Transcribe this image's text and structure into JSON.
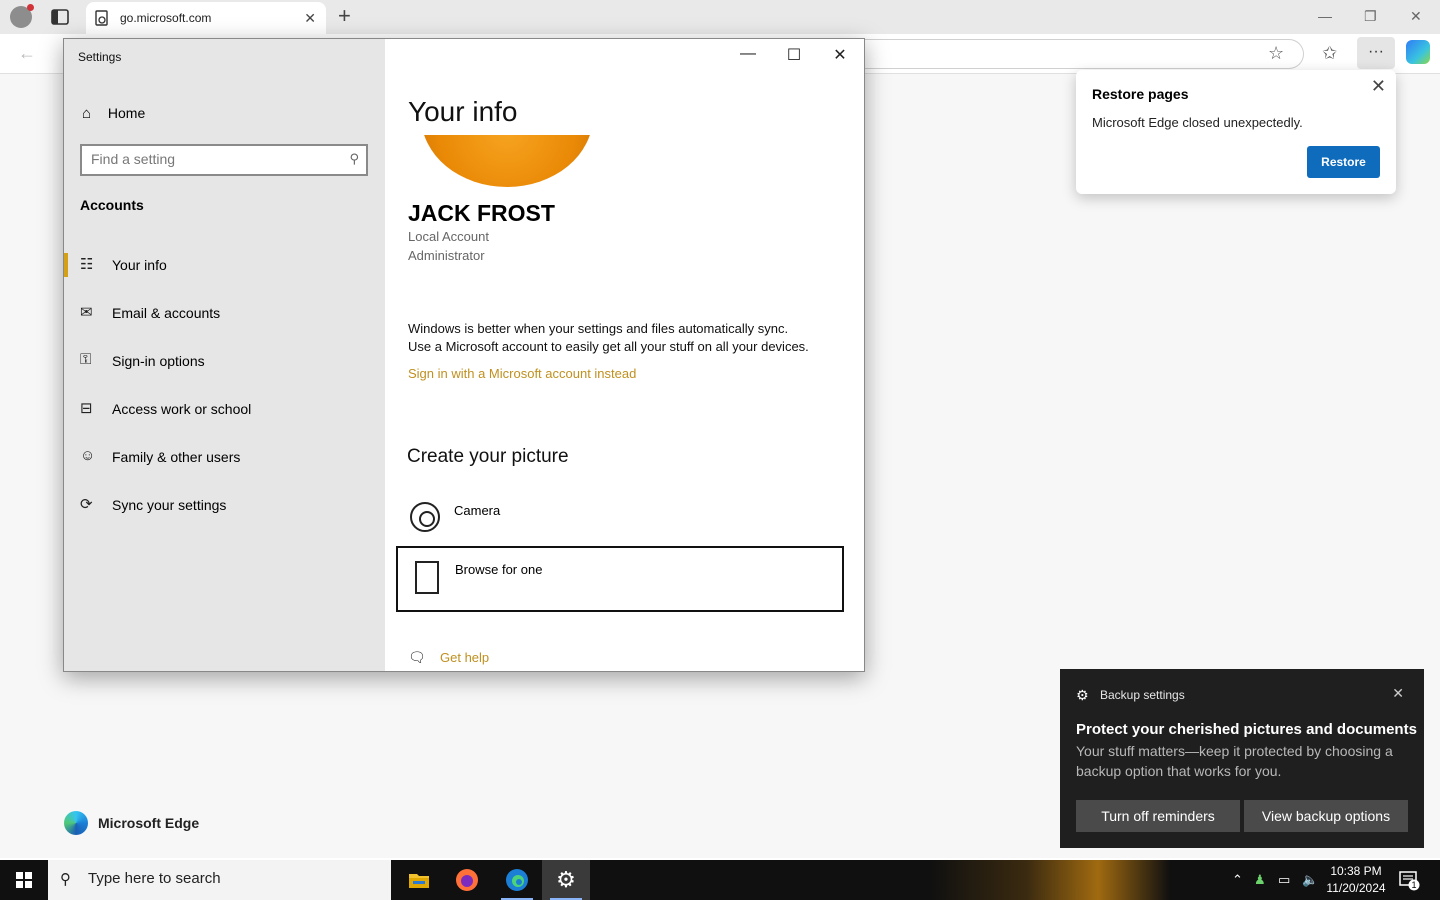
{
  "browser": {
    "tab_title": "go.microsoft.com",
    "tab_close": "✕",
    "new_tab": "+",
    "minimize": "—",
    "restore": "❐",
    "close": "✕"
  },
  "restore_popup": {
    "title": "Restore pages",
    "message": "Microsoft Edge closed unexpectedly.",
    "button": "Restore"
  },
  "settings": {
    "window_title": "Settings",
    "home_label": "Home",
    "search_placeholder": "Find a setting",
    "section_title": "Accounts",
    "nav": [
      {
        "label": "Your info",
        "icon": "your-info-icon",
        "active": true
      },
      {
        "label": "Email & accounts",
        "icon": "email-icon"
      },
      {
        "label": "Sign-in options",
        "icon": "key-icon"
      },
      {
        "label": "Access work or school",
        "icon": "briefcase-icon"
      },
      {
        "label": "Family & other users",
        "icon": "person-icon"
      },
      {
        "label": "Sync your settings",
        "icon": "sync-icon"
      }
    ],
    "main": {
      "heading": "Your info",
      "user_name": "JACK FROST",
      "account_type": "Local Account",
      "role": "Administrator",
      "sync_text_1": "Windows is better when your settings and files automatically sync.",
      "sync_text_2": "Use a Microsoft account to easily get all your stuff on all your devices.",
      "msa_link": "Sign in with a Microsoft account instead",
      "picture_heading": "Create your picture",
      "camera_label": "Camera",
      "browse_label": "Browse for one",
      "help_label": "Get help"
    }
  },
  "edge_brand": {
    "label": "Microsoft Edge"
  },
  "toast": {
    "app": "Backup settings",
    "heading": "Protect your cherished pictures and documents",
    "body": "Your stuff matters—keep it protected by choosing a backup option that works for you.",
    "button_1": "Turn off reminders",
    "button_2": "View backup options"
  },
  "taskbar": {
    "search_placeholder": "Type here to search",
    "time": "10:38 PM",
    "date": "11/20/2024",
    "notification_count": "1"
  },
  "colors": {
    "accent_link": "#c09020",
    "restore_button": "#0f6cbd",
    "active_indicator": "#d4a017"
  }
}
